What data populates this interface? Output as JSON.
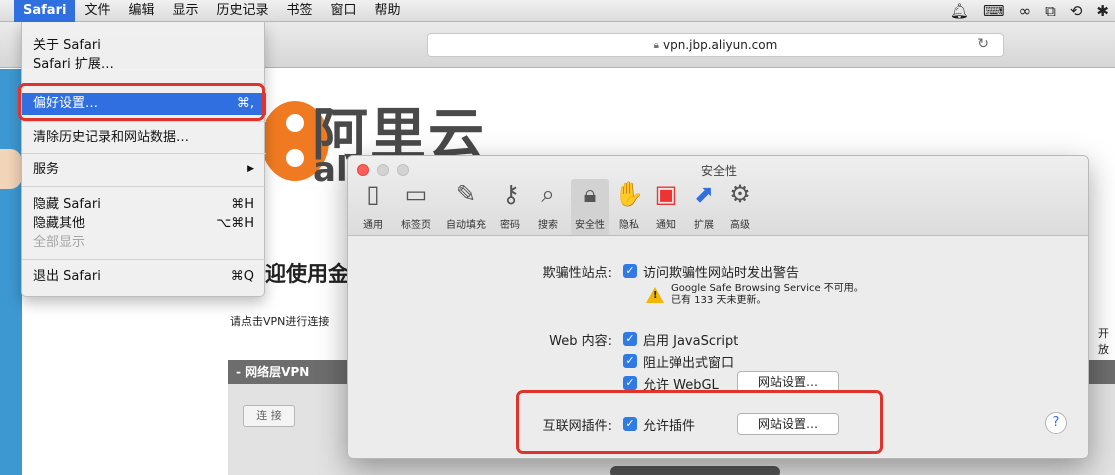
{
  "menubar": {
    "items": [
      "Safari",
      "文件",
      "编辑",
      "显示",
      "历史记录",
      "书签",
      "窗口",
      "帮助"
    ]
  },
  "browser": {
    "url": "vpn.jbp.aliyun.com"
  },
  "page": {
    "logo_cn": "阿里云",
    "logo_en": "ali",
    "welcome": "迎使用金",
    "instruction": "请点击VPN进行连接",
    "instruction_right": "开放",
    "vpn_section": "- 网络层VPN",
    "connect_label": "连 接"
  },
  "safari_menu": {
    "about": "关于 Safari",
    "extensions": "Safari 扩展…",
    "preferences": "偏好设置…",
    "preferences_shortcut": "⌘,",
    "clear_history": "清除历史记录和网站数据…",
    "services": "服务",
    "services_arrow": "▶",
    "hide_safari": "隐藏 Safari",
    "hide_safari_shortcut": "⌘H",
    "hide_others": "隐藏其他",
    "hide_others_shortcut": "⌥⌘H",
    "show_all": "全部显示",
    "quit": "退出 Safari",
    "quit_shortcut": "⌘Q"
  },
  "prefs": {
    "title": "安全性",
    "tabs": [
      {
        "label": "通用",
        "icon": "general-icon"
      },
      {
        "label": "标签页",
        "icon": "tabs-icon"
      },
      {
        "label": "自动填充",
        "icon": "autofill-icon"
      },
      {
        "label": "密码",
        "icon": "key-icon"
      },
      {
        "label": "搜索",
        "icon": "search-icon"
      },
      {
        "label": "安全性",
        "icon": "lock-icon"
      },
      {
        "label": "隐私",
        "icon": "hand-icon"
      },
      {
        "label": "通知",
        "icon": "notification-icon"
      },
      {
        "label": "扩展",
        "icon": "puzzle-icon"
      },
      {
        "label": "高级",
        "icon": "gear-icon"
      }
    ],
    "fraud_label": "欺骗性站点:",
    "fraud_check": "访问欺骗性网站时发出警告",
    "fraud_warning_1": "Google Safe Browsing Service 不可用。",
    "fraud_warning_2": "已有 133 天未更新。",
    "web_content_label": "Web 内容:",
    "enable_js": "启用 JavaScript",
    "block_popups": "阻止弹出式窗口",
    "allow_webgl": "允许 WebGL",
    "website_settings": "网站设置…",
    "plugins_label": "互联网插件:",
    "allow_plugins": "允许插件",
    "help": "?"
  },
  "colors": {
    "highlight": "#2f6fe0",
    "annotation_red": "#e0332c",
    "checkbox": "#2f7ae5"
  }
}
